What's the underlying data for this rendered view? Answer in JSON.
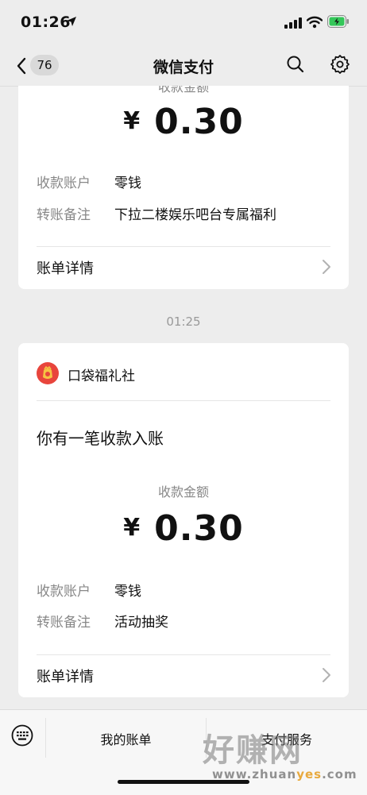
{
  "status": {
    "time": "01:26"
  },
  "nav": {
    "back_count": "76",
    "title": "微信支付"
  },
  "card1": {
    "amount_label": "收款金额",
    "currency": "¥",
    "amount": "0.30",
    "account_key": "收款账户",
    "account_val": "零钱",
    "remark_key": "转账备注",
    "remark_val": "下拉二楼娱乐吧台专属福利",
    "details": "账单详情"
  },
  "timestamp": "01:25",
  "card2": {
    "merchant": "口袋福礼社",
    "notice": "你有一笔收款入账",
    "amount_label": "收款金额",
    "currency": "¥",
    "amount": "0.30",
    "account_key": "收款账户",
    "account_val": "零钱",
    "remark_key": "转账备注",
    "remark_val": "活动抽奖",
    "details": "账单详情"
  },
  "bottom": {
    "menu1": "我的账单",
    "menu2": "支付服务"
  },
  "watermark": {
    "big": "好赚网",
    "small_a": "www.zhuan",
    "small_b": "yes",
    "small_c": ".com"
  },
  "colors": {
    "background": "#ededed",
    "card": "#ffffff",
    "battery": "#34c759",
    "merchant_icon": "#e8453c"
  },
  "icons": [
    "location-arrow-icon",
    "signal-icon",
    "wifi-icon",
    "battery-icon",
    "back-chevron-icon",
    "search-icon",
    "gear-icon",
    "chevron-right-icon",
    "fortune-bag-icon",
    "keyboard-icon"
  ]
}
